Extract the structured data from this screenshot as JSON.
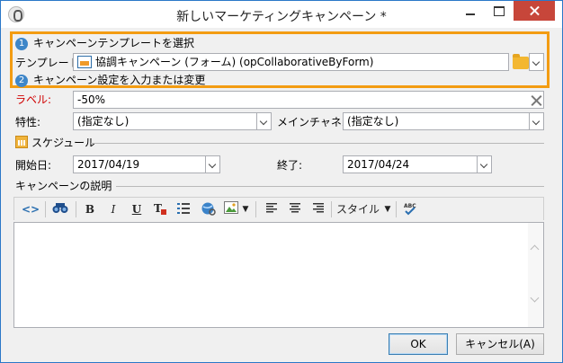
{
  "window": {
    "title": "新しいマーケティングキャンペーン *"
  },
  "steps": {
    "step1_number": "1",
    "step1_label": "キャンペーンテンプレートを選択",
    "step2_number": "2",
    "step2_label": "キャンペーン設定を入力または変更"
  },
  "template": {
    "label": "テンプレート:",
    "value": "協調キャンペーン (フォーム) (opCollaborativeByForm)"
  },
  "form": {
    "label_label": "ラベル:",
    "label_value": "-50%",
    "nature_label": "特性:",
    "nature_value": "(指定なし)",
    "channel_label": "メインチャネル:",
    "channel_value": "(指定なし)"
  },
  "schedule": {
    "section_label": "スケジュール",
    "start_label": "開始日:",
    "start_value": "2017/04/19",
    "end_label": "終了:",
    "end_value": "2017/04/24"
  },
  "description": {
    "section_label": "キャンペーンの説明",
    "toolbar": {
      "source_icon": "<>",
      "find_icon": "binoculars",
      "bold": "B",
      "italic": "I",
      "underline": "U",
      "style_label": "スタイル"
    }
  },
  "buttons": {
    "ok": "OK",
    "cancel": "キャンセル(A)"
  },
  "colors": {
    "highlight": "#f39c12",
    "step_badge": "#3e86c8",
    "close_button": "#c7463a",
    "required_label": "#d00000"
  }
}
